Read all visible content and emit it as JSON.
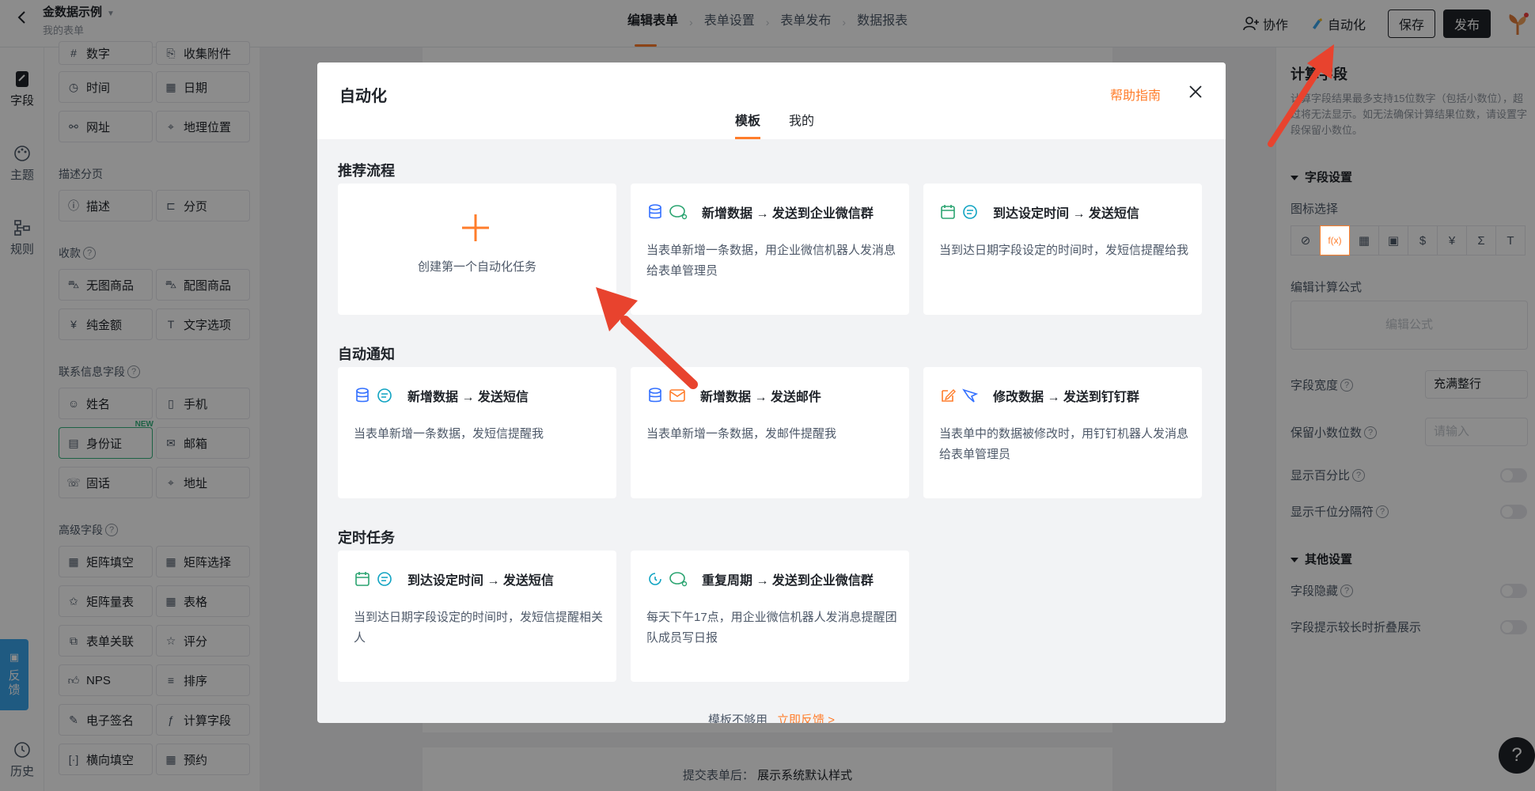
{
  "header": {
    "form_name": "金数据示例",
    "form_sub": "我的表单",
    "steps": [
      "编辑表单",
      "表单设置",
      "表单发布",
      "数据报表"
    ],
    "collab": "协作",
    "automation": "自动化",
    "save": "保存",
    "publish": "发布"
  },
  "rail": {
    "items": [
      "字段",
      "主题",
      "规则"
    ],
    "feedback": "反馈",
    "history": "历史"
  },
  "fields": {
    "top_partial": [
      "数字",
      "收集附件"
    ],
    "row_time": [
      "时间",
      "日期"
    ],
    "row_url": [
      "网址",
      "地理位置"
    ],
    "section_desc": "描述分页",
    "desc_items": [
      "描述",
      "分页"
    ],
    "section_pay": "收款",
    "pay_items": [
      "无图商品",
      "配图商品",
      "纯金额",
      "文字选项"
    ],
    "section_contact": "联系信息字段",
    "contact_items": [
      "姓名",
      "手机",
      "身份证",
      "邮箱",
      "固话",
      "地址"
    ],
    "new_tag": "NEW",
    "section_adv": "高级字段",
    "adv_items": [
      "矩阵填空",
      "矩阵选择",
      "矩阵量表",
      "表格",
      "表单关联",
      "评分",
      "NPS",
      "排序",
      "电子签名",
      "计算字段",
      "横向填空",
      "预约"
    ]
  },
  "canvas": {
    "footer_label": "提交表单后：",
    "footer_value": "展示系统默认样式"
  },
  "props": {
    "title": "计算字段",
    "desc": "计算字段结果最多支持15位数字（包括小数位），超过将无法显示。如无法确保计算结果位数，请设置字段保留小数位。",
    "field_settings": "字段设置",
    "icon_select": "图标选择",
    "icons": [
      "⊘",
      "f(x)",
      "▦",
      "▣",
      "$",
      "¥",
      "Σ",
      "T"
    ],
    "edit_formula": "编辑计算公式",
    "formula_placeholder": "编辑公式",
    "width_label": "字段宽度",
    "width_value": "充满整行",
    "decimals_label": "保留小数位数",
    "decimals_placeholder": "请输入",
    "show_percent": "显示百分比",
    "show_thousands": "显示千位分隔符",
    "other_settings": "其他设置",
    "hide_field": "字段隐藏",
    "collapse_hint": "字段提示较长时折叠展示"
  },
  "modal": {
    "title": "自动化",
    "help": "帮助指南",
    "tabs": [
      "模板",
      "我的"
    ],
    "groups": {
      "recommended": "推荐流程",
      "notify": "自动通知",
      "scheduled": "定时任务"
    },
    "create_label": "创建第一个自动化任务",
    "cards": [
      {
        "title": "新增数据 → 发送到企业微信群",
        "desc": "当表单新增一条数据，用企业微信机器人发消息给表单管理员"
      },
      {
        "title": "到达设定时间 → 发送短信",
        "desc": "当到达日期字段设定的时间时，发短信提醒给我"
      },
      {
        "title": "新增数据 → 发送短信",
        "desc": "当表单新增一条数据，发短信提醒我"
      },
      {
        "title": "新增数据 → 发送邮件",
        "desc": "当表单新增一条数据，发邮件提醒我"
      },
      {
        "title": "修改数据 → 发送到钉钉群",
        "desc": "当表单中的数据被修改时，用钉钉机器人发消息给表单管理员"
      },
      {
        "title": "到达设定时间 → 发送短信",
        "desc": "当到达日期字段设定的时间时，发短信提醒相关人"
      },
      {
        "title": "重复周期 → 发送到企业微信群",
        "desc": "每天下午17点，用企业微信机器人发消息提醒团队成员写日报"
      }
    ],
    "footer_text": "模板不够用",
    "footer_link": "立即反馈 >"
  },
  "colors": {
    "accent": "#ff7d2b",
    "dark": "#1f2329",
    "annotation_arrow": "#e8432e",
    "feedback_tab": "#3aa4ec"
  }
}
